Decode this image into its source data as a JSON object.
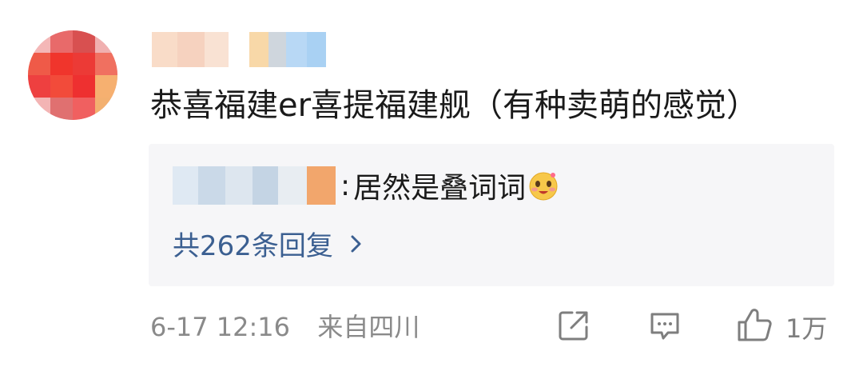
{
  "comment": {
    "avatar": {
      "icon": "avatar-mosaic",
      "colors": [
        "#f4b7b7",
        "#e86a6a",
        "#d85050",
        "#f0b0b0",
        "#ef5a48",
        "#f0352c",
        "#ec3a36",
        "#f07060",
        "#ee4040",
        "#f24b3a",
        "#ee3030",
        "#f6b070",
        "#f3b4b4",
        "#e07070",
        "#f06060",
        "#f3b070"
      ]
    },
    "nickname_blur_colors": [
      "#f9dcc8",
      "#f6d2bf",
      "#f9e2d3"
    ],
    "badge_blur_colors": [
      "#f8d8a8",
      "#cfd6dd",
      "#b8d8f5",
      "#a9d1f3"
    ],
    "text": "恭喜福建er喜提福建舰（有种卖萌的感觉）"
  },
  "reply": {
    "name_blur_colors": [
      "#dfe9f3",
      "#cad9e8",
      "#dde6ef",
      "#c4d4e4",
      "#e8edf2",
      "#f2a66c"
    ],
    "separator": ":",
    "text": "居然是叠词词",
    "emoji": "blush-emoji",
    "count_label": "共262条回复",
    "count_icon": "chevron-right-icon",
    "accent_color": "#3b5f91"
  },
  "footer": {
    "timestamp": "6-17 12:16",
    "location": "来自四川",
    "share_icon": "share-icon",
    "comment_icon": "comment-icon",
    "like_icon": "thumbs-up-icon",
    "like_count": "1万"
  }
}
